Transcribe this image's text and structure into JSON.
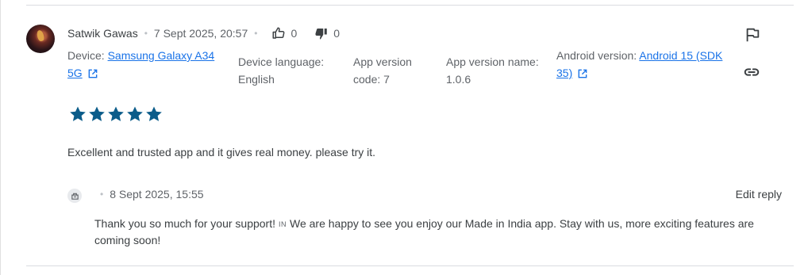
{
  "review": {
    "author": "Satwik Gawas",
    "date": "7 Sept 2025, 20:57",
    "thumbs_up_count": "0",
    "thumbs_down_count": "0",
    "device_label": "Device: ",
    "device_link_1": "Samsung Galaxy A34",
    "device_link_2": "5G",
    "language_label": "Device language:",
    "language_value": "English",
    "version_code_label": "App version",
    "version_code_value": "code: 7",
    "version_name_label": "App version name:",
    "version_name_value": "1.0.6",
    "android_label": "Android version: ",
    "android_link_1": "Android 15 (SDK",
    "android_link_2": "35)",
    "rating": 5,
    "text": "Excellent and trusted app and it gives real money. please try it."
  },
  "reply": {
    "date": "8 Sept 2025, 15:55",
    "edit_label": "Edit reply",
    "text_before": "Thank you so much for your support!",
    "flag": "IN",
    "text_after": "We are happy to see you enjoy our Made in India app. Stay with us, more exciting features are coming soon!"
  },
  "icons": {
    "thumbs_up": "thumbs-up-icon",
    "thumbs_down": "thumbs-down-icon",
    "flag": "flag-icon",
    "link": "link-icon",
    "external": "open-in-new-icon",
    "star": "star-icon",
    "developer": "developer-icon"
  },
  "colors": {
    "star": "#0b5c8a",
    "link": "#1a73e8",
    "text": "#3c4043",
    "secondary": "#5f6368"
  }
}
